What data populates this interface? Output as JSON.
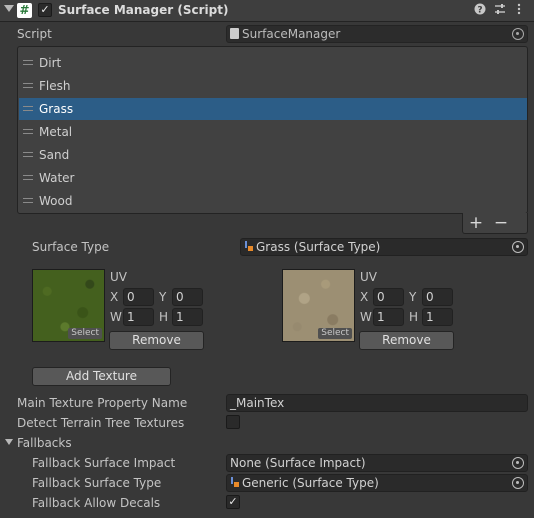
{
  "header": {
    "script_glyph": "#",
    "enabled_check": "✓",
    "title": "Surface Manager (Script)",
    "help_icon": "help-icon",
    "settings_icon": "preset-sliders-icon",
    "menu_icon": "kebab-menu-icon"
  },
  "script": {
    "label": "Script",
    "value": "SurfaceManager"
  },
  "surface_list": {
    "items": [
      "Dirt",
      "Flesh",
      "Grass",
      "Metal",
      "Sand",
      "Water",
      "Wood"
    ],
    "selected": "Grass",
    "add_label": "+",
    "remove_label": "−"
  },
  "surface_type": {
    "label": "Surface Type",
    "value": "Grass (Surface Type)"
  },
  "textures": [
    {
      "thumbnail": "grass-texture",
      "select_label": "Select",
      "uv_label": "UV",
      "x_label": "X",
      "x": "0",
      "y_label": "Y",
      "y": "0",
      "w_label": "W",
      "w": "1",
      "h_label": "H",
      "h": "1",
      "remove_label": "Remove"
    },
    {
      "thumbnail": "gravel-texture",
      "select_label": "Select",
      "uv_label": "UV",
      "x_label": "X",
      "x": "0",
      "y_label": "Y",
      "y": "0",
      "w_label": "W",
      "w": "1",
      "h_label": "H",
      "h": "1",
      "remove_label": "Remove"
    }
  ],
  "add_texture_label": "Add Texture",
  "main_texture_property": {
    "label": "Main Texture Property Name",
    "value": "_MainTex"
  },
  "detect_terrain": {
    "label": "Detect Terrain Tree Textures",
    "checked": false
  },
  "fallbacks": {
    "label": "Fallbacks",
    "impact_label": "Fallback Surface Impact",
    "impact_value": "None (Surface Impact)",
    "type_label": "Fallback Surface Type",
    "type_value": "Generic (Surface Type)",
    "decals_label": "Fallback Allow Decals",
    "decals_check": "✓"
  },
  "colors": {
    "background": "#383838",
    "selected_row": "#2c5d87",
    "field": "#2a2a2a",
    "button": "#585858"
  }
}
